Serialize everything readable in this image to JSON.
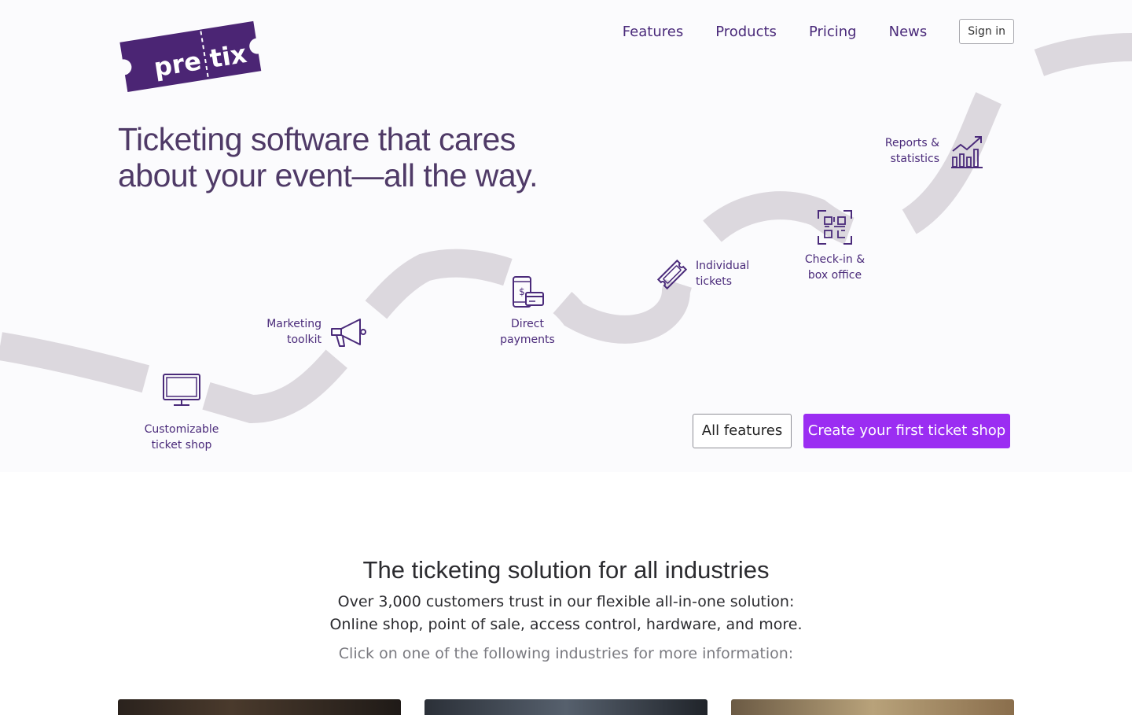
{
  "brand": {
    "logo_text_left": "pre",
    "logo_text_right": "tix",
    "logo_color": "#4b2574"
  },
  "nav": {
    "items": [
      "Features",
      "Products",
      "Pricing",
      "News"
    ],
    "sign_in": "Sign in"
  },
  "hero": {
    "headline_line1": "Ticketing software that cares",
    "headline_line2": "about your event—all the way.",
    "features": [
      {
        "line1": "Customizable",
        "line2": "ticket shop",
        "icon": "monitor-icon"
      },
      {
        "line1": "Marketing",
        "line2": "toolkit",
        "icon": "megaphone-icon"
      },
      {
        "line1": "Direct",
        "line2": "payments",
        "icon": "phone-payment-icon"
      },
      {
        "line1": "Individual",
        "line2": "tickets",
        "icon": "ticket-icon"
      },
      {
        "line1": "Check-in &",
        "line2": "box office",
        "icon": "qr-code-icon"
      },
      {
        "line1": "Reports &",
        "line2": "statistics",
        "icon": "chart-growth-icon"
      }
    ],
    "buttons": {
      "all_features": "All features",
      "create_shop": "Create your first ticket shop"
    }
  },
  "industries": {
    "title": "The ticketing solution for all industries",
    "subtitle_line1": "Over 3,000 customers trust in our flexible all-in-one solution:",
    "subtitle_line2": "Online shop, point of sale, access control, hardware, and more.",
    "hint": "Click on one of the following industries for more information:"
  },
  "colors": {
    "accent": "#9b2df2",
    "brand_purple": "#4b2574",
    "road": "#dcd8de",
    "hero_bg": "#fbfbfd"
  }
}
